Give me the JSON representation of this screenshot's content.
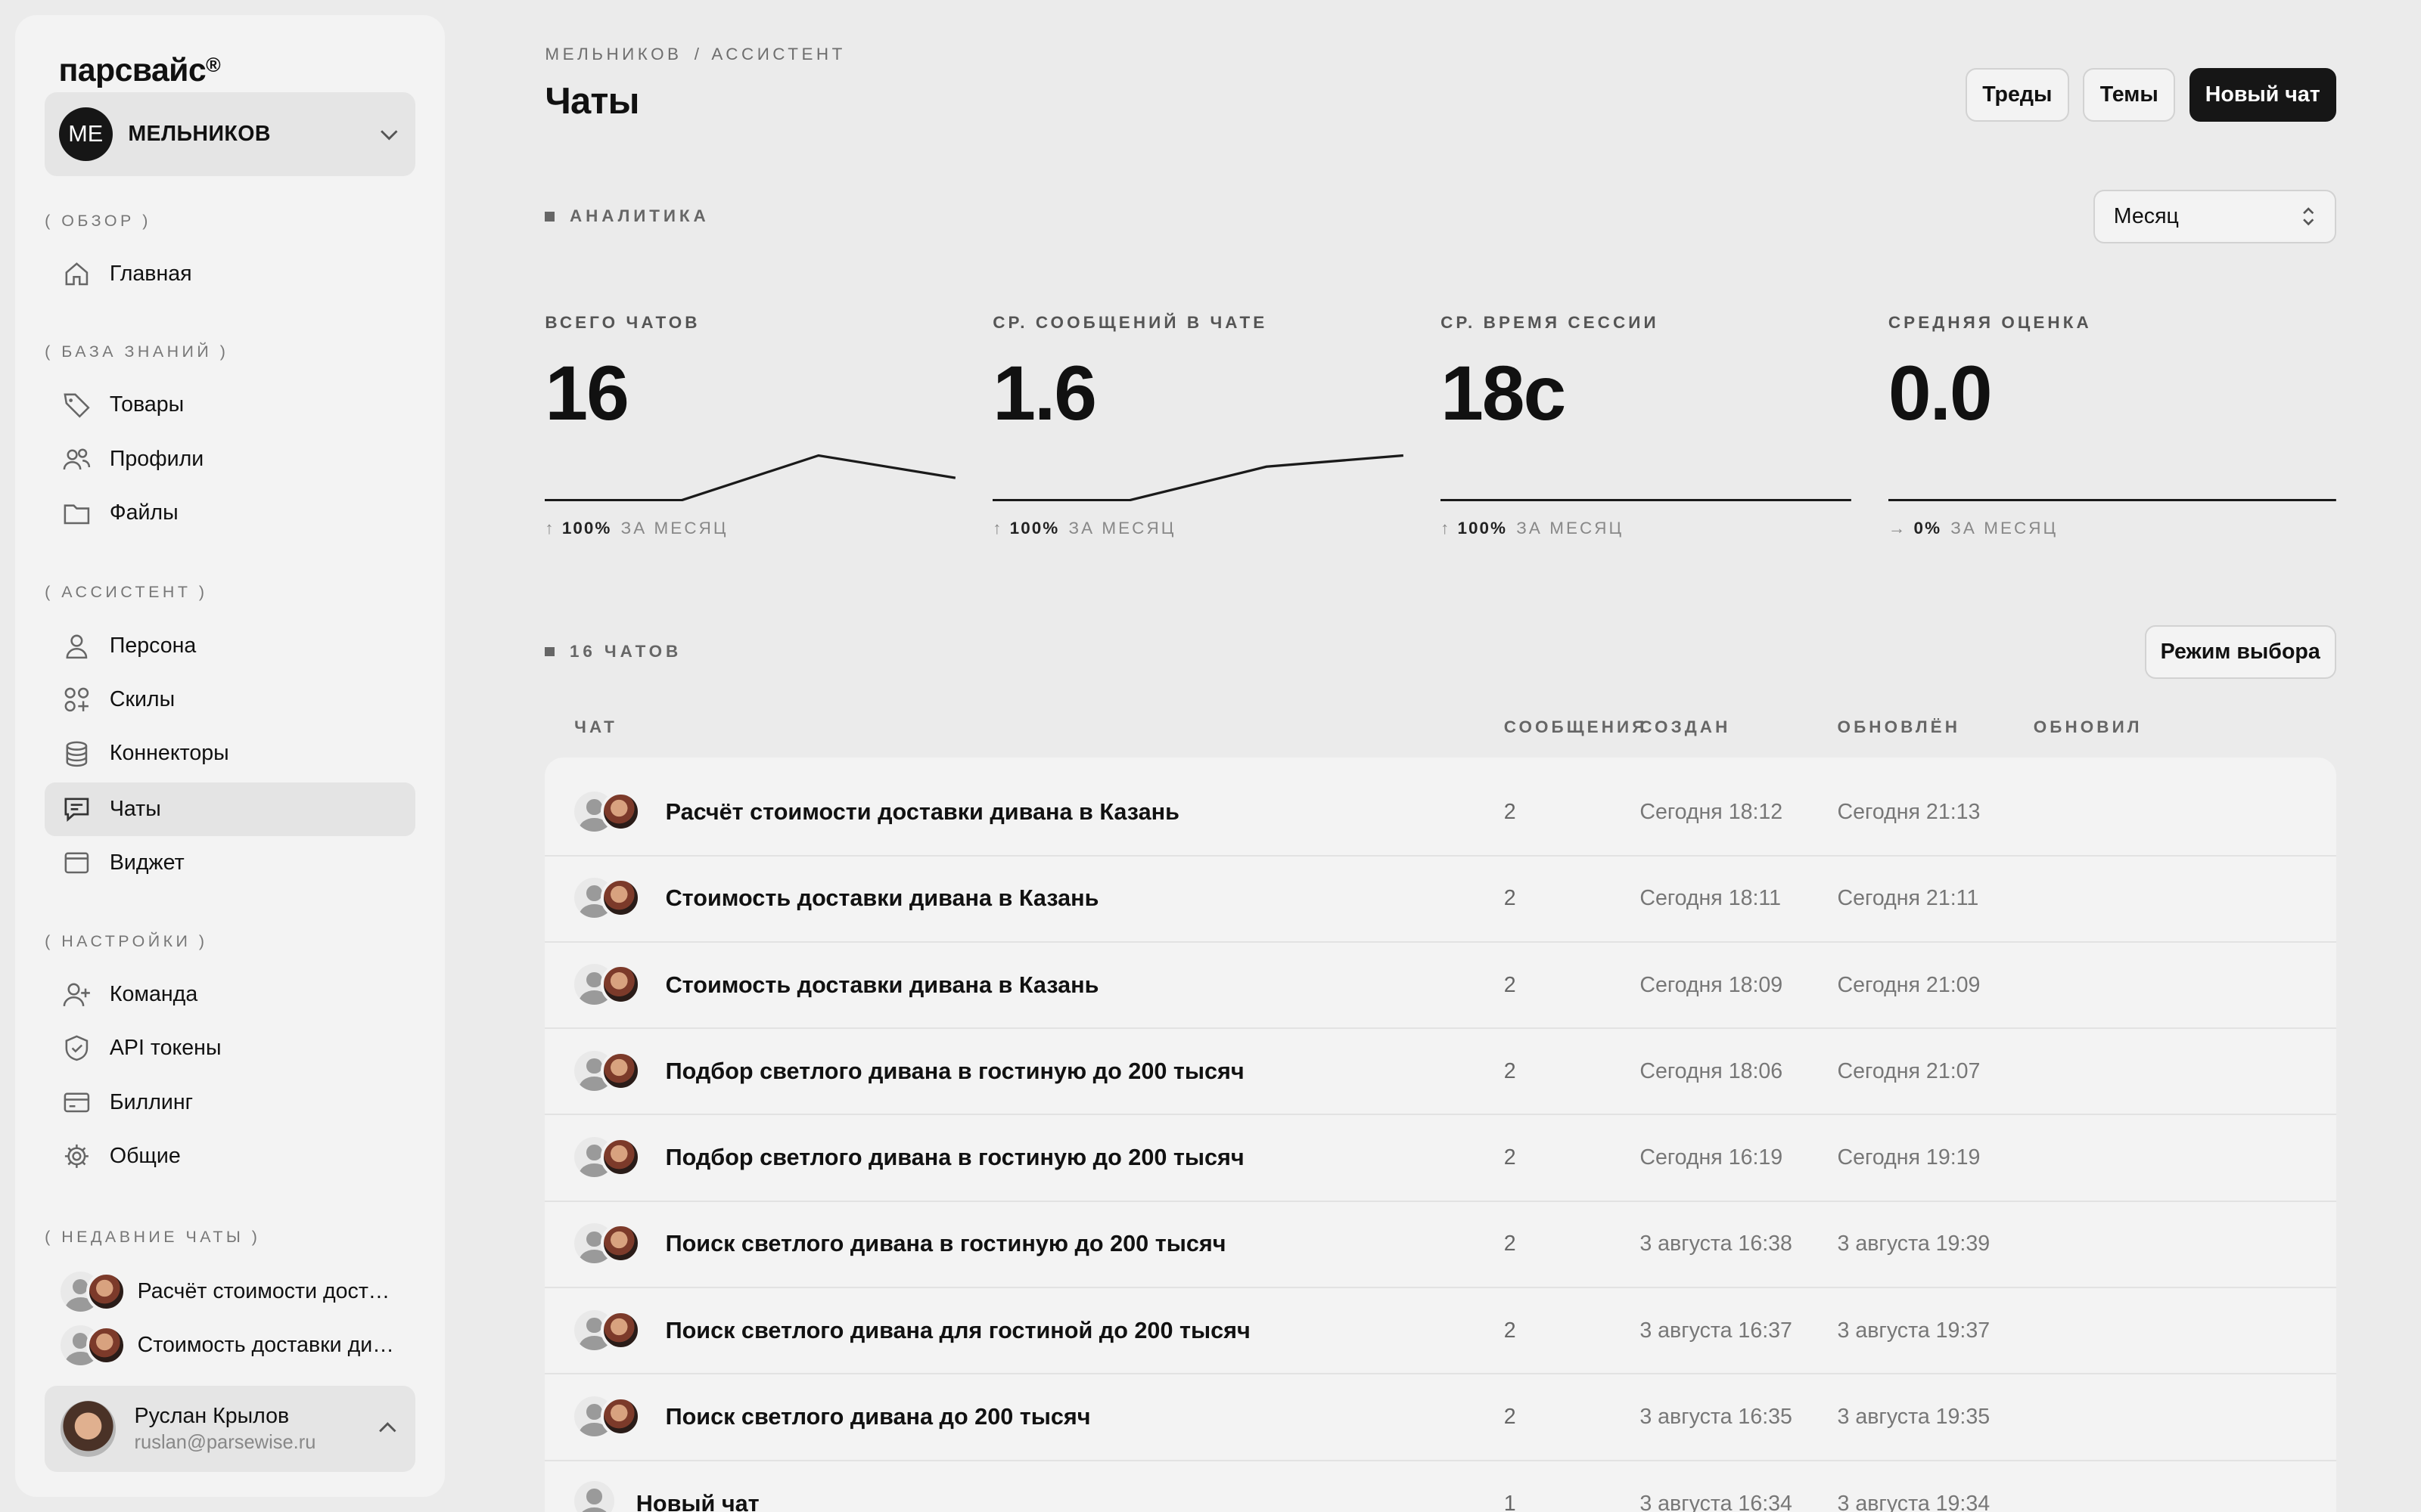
{
  "sidebar": {
    "logo": "парсвайс",
    "logo_mark": "®",
    "workspace": {
      "initials": "МЕ",
      "name": "МЕЛЬНИКОВ"
    },
    "sections": {
      "overview": "( ОБЗОР )",
      "knowledge": "( БАЗА ЗНАНИЙ )",
      "assistant": "( АССИСТЕНТ )",
      "settings": "( НАСТРОЙКИ )",
      "recent": "( НЕДАВНИЕ ЧАТЫ )"
    },
    "items": {
      "home": "Главная",
      "products": "Товары",
      "profiles": "Профили",
      "files": "Файлы",
      "persona": "Персона",
      "skills": "Скилы",
      "connectors": "Коннекторы",
      "chats": "Чаты",
      "widget": "Виджет",
      "team": "Команда",
      "api": "API токены",
      "billing": "Биллинг",
      "general": "Общие"
    },
    "recent_chats": [
      "Расчёт стоимости доставки дивана в Казань",
      "Стоимость доставки дивана в Казань"
    ],
    "user": {
      "name": "Руслан Крылов",
      "email": "ruslan@parsewise.ru"
    }
  },
  "header": {
    "crumb_1": "МЕЛЬНИКОВ",
    "crumb_sep": "/",
    "crumb_2": "АССИСТЕНТ",
    "title": "Чаты",
    "buttons": {
      "threads": "Треды",
      "topics": "Темы",
      "new_chat": "Новый чат"
    }
  },
  "analytics": {
    "label": "АНАЛИТИКА",
    "period": "Месяц",
    "stats": [
      {
        "label": "ВСЕГО ЧАТОВ",
        "value": "16",
        "delta": "100%",
        "suffix": "ЗА МЕСЯЦ",
        "arrow": "↑",
        "trend": [
          0,
          0,
          1,
          0.5
        ]
      },
      {
        "label": "СР. СООБЩЕНИЙ В ЧАТЕ",
        "value": "1.6",
        "delta": "100%",
        "suffix": "ЗА МЕСЯЦ",
        "arrow": "↑",
        "trend": [
          0,
          0,
          0.75,
          1
        ]
      },
      {
        "label": "СР. ВРЕМЯ СЕССИИ",
        "value": "18с",
        "delta": "100%",
        "suffix": "ЗА МЕСЯЦ",
        "arrow": "↑",
        "trend": [
          0,
          0,
          0,
          0
        ]
      },
      {
        "label": "СРЕДНЯЯ ОЦЕНКА",
        "value": "0.0",
        "delta": "0%",
        "suffix": "ЗА МЕСЯЦ",
        "arrow": "→",
        "trend": [
          0,
          0,
          0,
          0
        ]
      }
    ]
  },
  "chats": {
    "label": "16 ЧАТОВ",
    "select_mode": "Режим выбора",
    "columns": {
      "chat": "ЧАТ",
      "messages": "СООБЩЕНИЯ",
      "created": "СОЗДАН",
      "updated": "ОБНОВЛЁН",
      "updated_by": "ОБНОВИЛ"
    },
    "rows": [
      {
        "title": "Расчёт стоимости доставки дивана в Казань",
        "count": "2",
        "created": "Сегодня 18:12",
        "updated": "Сегодня 21:13"
      },
      {
        "title": "Стоимость доставки дивана в Казань",
        "count": "2",
        "created": "Сегодня 18:11",
        "updated": "Сегодня 21:11"
      },
      {
        "title": "Стоимость доставки дивана в Казань",
        "count": "2",
        "created": "Сегодня 18:09",
        "updated": "Сегодня 21:09"
      },
      {
        "title": "Подбор светлого дивана в гостиную до 200 тысяч",
        "count": "2",
        "created": "Сегодня 18:06",
        "updated": "Сегодня 21:07"
      },
      {
        "title": "Подбор светлого дивана в гостиную до 200 тысяч",
        "count": "2",
        "created": "Сегодня 16:19",
        "updated": "Сегодня 19:19"
      },
      {
        "title": "Поиск светлого дивана в гостиную до 200 тысяч",
        "count": "2",
        "created": "3 августа 16:38",
        "updated": "3 августа 19:39"
      },
      {
        "title": "Поиск светлого дивана для гостиной до 200 тысяч",
        "count": "2",
        "created": "3 августа 16:37",
        "updated": "3 августа 19:37"
      },
      {
        "title": "Поиск светлого дивана до 200 тысяч",
        "count": "2",
        "created": "3 августа 16:35",
        "updated": "3 августа 19:35"
      },
      {
        "title": "Новый чат",
        "count": "1",
        "created": "3 августа 16:34",
        "updated": "3 августа 19:34"
      }
    ]
  }
}
